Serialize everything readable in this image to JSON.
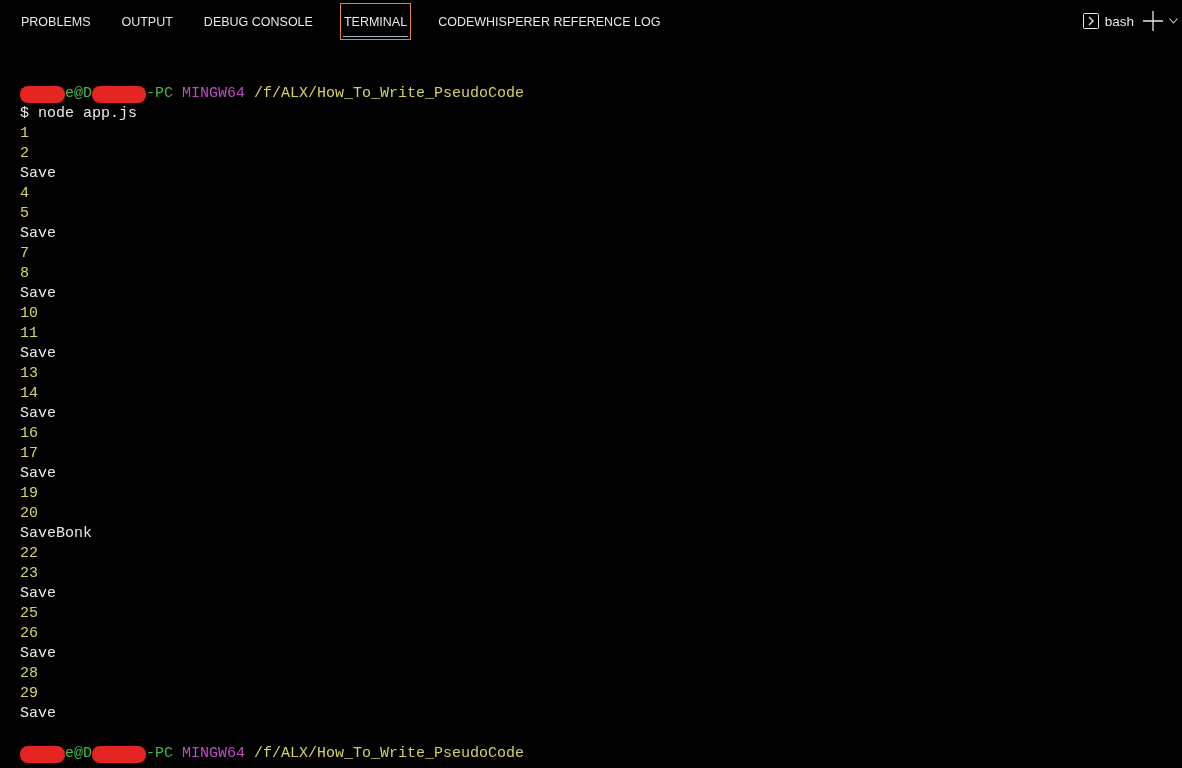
{
  "panel_tabs": [
    {
      "label": "PROBLEMS",
      "selected": false
    },
    {
      "label": "OUTPUT",
      "selected": false
    },
    {
      "label": "DEBUG CONSOLE",
      "selected": false
    },
    {
      "label": "TERMINAL",
      "selected": true
    },
    {
      "label": "CODEWHISPERER REFERENCE LOG",
      "selected": false
    }
  ],
  "terminal_toolbar": {
    "shell": "bash"
  },
  "terminal": {
    "lines": [
      {
        "kind": "prompt",
        "segments": [
          {
            "kind": "redacted"
          },
          {
            "kind": "user",
            "text": "e@D"
          },
          {
            "kind": "redacted"
          },
          {
            "kind": "user",
            "text": "-PC"
          },
          {
            "kind": "system",
            "text": "MINGW64"
          },
          {
            "kind": "path",
            "text": "/f/ALX/How_To_Write_PseudoCode"
          }
        ]
      },
      {
        "kind": "command",
        "text": "$ node app.js"
      },
      {
        "kind": "number",
        "text": "1"
      },
      {
        "kind": "number",
        "text": "2"
      },
      {
        "kind": "text",
        "text": "Save"
      },
      {
        "kind": "number",
        "text": "4"
      },
      {
        "kind": "number",
        "text": "5"
      },
      {
        "kind": "text",
        "text": "Save"
      },
      {
        "kind": "number",
        "text": "7"
      },
      {
        "kind": "number",
        "text": "8"
      },
      {
        "kind": "text",
        "text": "Save"
      },
      {
        "kind": "number",
        "text": "10"
      },
      {
        "kind": "number",
        "text": "11"
      },
      {
        "kind": "text",
        "text": "Save"
      },
      {
        "kind": "number",
        "text": "13"
      },
      {
        "kind": "number",
        "text": "14"
      },
      {
        "kind": "text",
        "text": "Save"
      },
      {
        "kind": "number",
        "text": "16"
      },
      {
        "kind": "number",
        "text": "17"
      },
      {
        "kind": "text",
        "text": "Save"
      },
      {
        "kind": "number",
        "text": "19"
      },
      {
        "kind": "number",
        "text": "20"
      },
      {
        "kind": "text",
        "text": "SaveBonk"
      },
      {
        "kind": "number",
        "text": "22"
      },
      {
        "kind": "number",
        "text": "23"
      },
      {
        "kind": "text",
        "text": "Save"
      },
      {
        "kind": "number",
        "text": "25"
      },
      {
        "kind": "number",
        "text": "26"
      },
      {
        "kind": "text",
        "text": "Save"
      },
      {
        "kind": "number",
        "text": "28"
      },
      {
        "kind": "number",
        "text": "29"
      },
      {
        "kind": "text",
        "text": "Save"
      },
      {
        "kind": "blank"
      },
      {
        "kind": "prompt",
        "segments": [
          {
            "kind": "redacted"
          },
          {
            "kind": "user",
            "text": "e@D"
          },
          {
            "kind": "redacted"
          },
          {
            "kind": "user",
            "text": "-PC"
          },
          {
            "kind": "system",
            "text": "MINGW64"
          },
          {
            "kind": "path",
            "text": "/f/ALX/How_To_Write_PseudoCode"
          }
        ]
      }
    ]
  }
}
